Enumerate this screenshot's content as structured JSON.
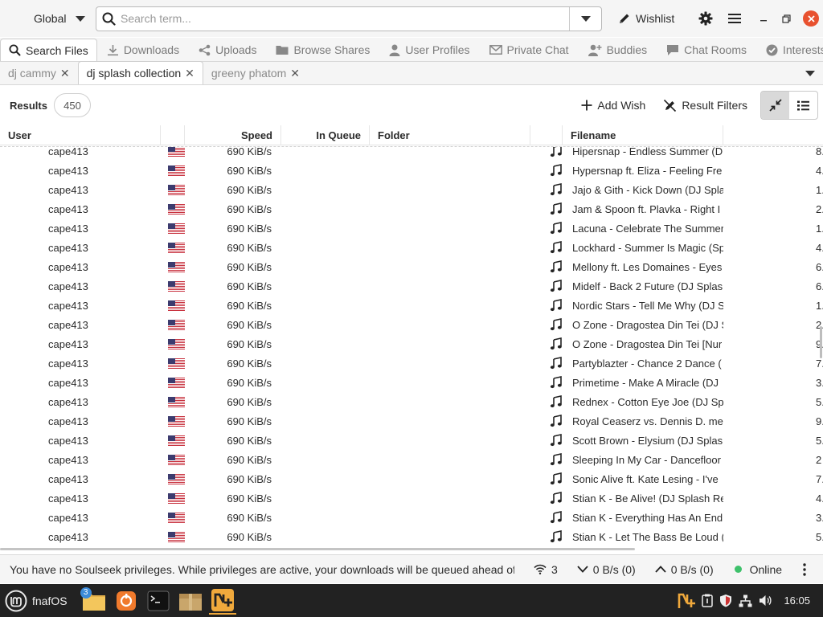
{
  "header": {
    "scope_label": "Global",
    "search_placeholder": "Search term...",
    "wishlist_label": "Wishlist"
  },
  "nav_tabs": [
    {
      "label": "Search Files",
      "icon": "search-icon"
    },
    {
      "label": "Downloads",
      "icon": "download-icon"
    },
    {
      "label": "Uploads",
      "icon": "share-icon"
    },
    {
      "label": "Browse Shares",
      "icon": "folder-icon"
    },
    {
      "label": "User Profiles",
      "icon": "person-icon"
    },
    {
      "label": "Private Chat",
      "icon": "envelope-icon"
    },
    {
      "label": "Buddies",
      "icon": "add-user-icon"
    },
    {
      "label": "Chat Rooms",
      "icon": "speech-bubble-icon"
    },
    {
      "label": "Interests",
      "icon": "check-circle-icon"
    }
  ],
  "search_tabs": [
    {
      "label": "dj cammy",
      "active": false
    },
    {
      "label": "dj splash collection",
      "active": true
    },
    {
      "label": "greeny phatom",
      "active": false
    }
  ],
  "results": {
    "label": "Results",
    "count": "450",
    "add_wish_label": "Add Wish",
    "filters_label": "Result Filters"
  },
  "columns": {
    "user": "User",
    "speed": "Speed",
    "in_queue": "In Queue",
    "folder": "Folder",
    "filename": "Filename"
  },
  "rows": [
    {
      "user": "cape413",
      "speed": "690 KiB/s",
      "filename": "Hipersnap - Endless Summer (D",
      "size": "8."
    },
    {
      "user": "cape413",
      "speed": "690 KiB/s",
      "filename": "Hypersnap ft. Eliza - Feeling Fre",
      "size": "4."
    },
    {
      "user": "cape413",
      "speed": "690 KiB/s",
      "filename": "Jajo & Gith - Kick Down (DJ Spla",
      "size": "1."
    },
    {
      "user": "cape413",
      "speed": "690 KiB/s",
      "filename": "Jam & Spoon ft. Plavka - Right I",
      "size": "2."
    },
    {
      "user": "cape413",
      "speed": "690 KiB/s",
      "filename": "Lacuna - Celebrate The Summer",
      "size": "1."
    },
    {
      "user": "cape413",
      "speed": "690 KiB/s",
      "filename": "Lockhard - Summer Is Magic (Sp",
      "size": "4."
    },
    {
      "user": "cape413",
      "speed": "690 KiB/s",
      "filename": "Mellony ft. Les Domaines - Eyes",
      "size": "6."
    },
    {
      "user": "cape413",
      "speed": "690 KiB/s",
      "filename": "Midelf - Back 2 Future (DJ Splas",
      "size": "6."
    },
    {
      "user": "cape413",
      "speed": "690 KiB/s",
      "filename": "Nordic Stars - Tell Me Why (DJ S",
      "size": "1."
    },
    {
      "user": "cape413",
      "speed": "690 KiB/s",
      "filename": "O Zone - Dragostea Din Tei (DJ S",
      "size": "2."
    },
    {
      "user": "cape413",
      "speed": "690 KiB/s",
      "filename": "O Zone - Dragostea Din Tei [Nur",
      "size": "9."
    },
    {
      "user": "cape413",
      "speed": "690 KiB/s",
      "filename": "Partyblazter - Chance 2 Dance (",
      "size": "7."
    },
    {
      "user": "cape413",
      "speed": "690 KiB/s",
      "filename": "Primetime - Make A Miracle (DJ",
      "size": "3."
    },
    {
      "user": "cape413",
      "speed": "690 KiB/s",
      "filename": "Rednex - Cotton Eye Joe (DJ Sp",
      "size": "5."
    },
    {
      "user": "cape413",
      "speed": "690 KiB/s",
      "filename": "Royal Ceaserz vs. Dennis D. mee",
      "size": "9."
    },
    {
      "user": "cape413",
      "speed": "690 KiB/s",
      "filename": "Scott Brown - Elysium (DJ Splas",
      "size": "5."
    },
    {
      "user": "cape413",
      "speed": "690 KiB/s",
      "filename": "Sleeping In My Car - Dancefloor",
      "size": "2"
    },
    {
      "user": "cape413",
      "speed": "690 KiB/s",
      "filename": "Sonic Alive ft. Kate Lesing - I've",
      "size": "7."
    },
    {
      "user": "cape413",
      "speed": "690 KiB/s",
      "filename": "Stian K - Be Alive! (DJ Splash Re",
      "size": "4."
    },
    {
      "user": "cape413",
      "speed": "690 KiB/s",
      "filename": "Stian K - Everything Has An End",
      "size": "3."
    },
    {
      "user": "cape413",
      "speed": "690 KiB/s",
      "filename": "Stian K - Let The Bass Be Loud (",
      "size": "5."
    }
  ],
  "status": {
    "message": "You have no Soulseek privileges. While privileges are active, your downloads will be queued ahead of ...",
    "connections": "3",
    "download_speed": "0 B/s (0)",
    "upload_speed": "0 B/s (0)",
    "online_label": "Online"
  },
  "taskbar": {
    "menu_label": "fnafOS",
    "files_badge": "3",
    "clock": "16:05"
  },
  "colors": {
    "close_button": "#e8512f",
    "online_dot": "#3ec16b",
    "taskbar_bg": "#222222",
    "active_app_accent": "#f0a93c"
  }
}
